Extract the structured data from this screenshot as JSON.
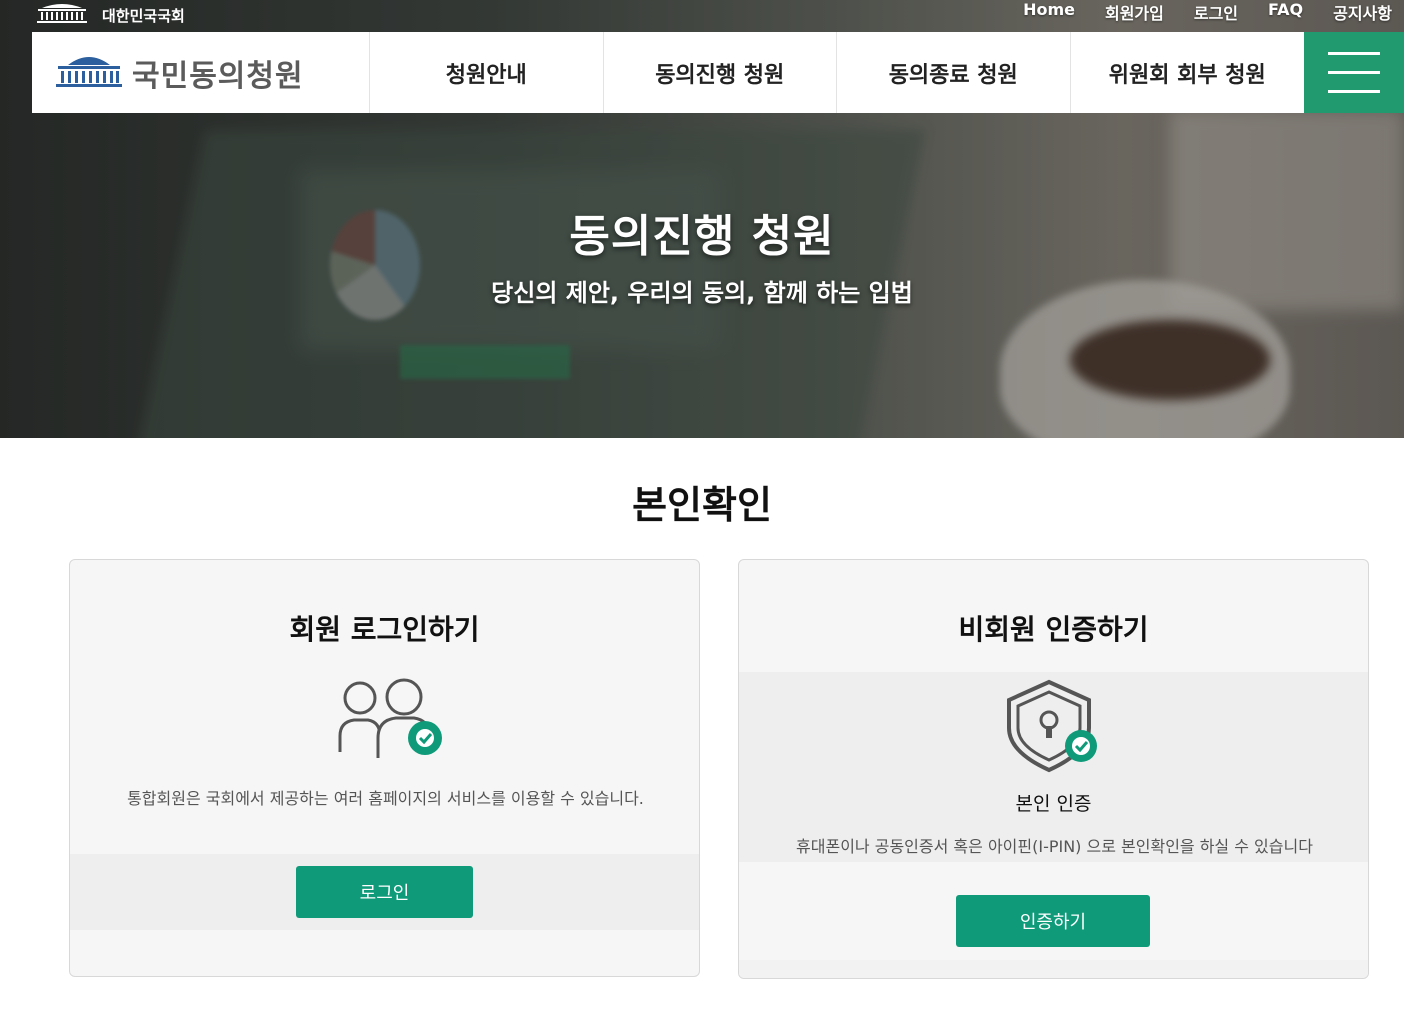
{
  "utility_bar": {
    "assembly_name": "대한민국국회",
    "links": [
      "Home",
      "회원가입",
      "로그인",
      "FAQ",
      "공지사항"
    ]
  },
  "nav": {
    "logo_text": "국민동의청원",
    "menu": [
      "청원안내",
      "동의진행 청원",
      "동의종료 청원",
      "위원회 회부 청원"
    ]
  },
  "hero": {
    "title": "동의진행 청원",
    "subtitle": "당신의 제안, 우리의 동의, 함께 하는 입법"
  },
  "main": {
    "section_title": "본인확인",
    "member_card": {
      "title": "회원 로그인하기",
      "icon": "users-check-icon",
      "description": "통합회원은 국회에서 제공하는 여러 홈페이지의 서비스를 이용할 수 있습니다.",
      "button_label": "로그인"
    },
    "guest_card": {
      "title": "비회원 인증하기",
      "icon": "shield-lock-check-icon",
      "cert_label": "본인 인증",
      "description": "휴대폰이나 공동인증서 혹은 아이핀(I-PIN) 으로 본인확인을 하실 수 있습니다",
      "button_label": "인증하기"
    }
  },
  "colors": {
    "accent_green": "#219a6f",
    "button_green": "#0f9a79"
  }
}
